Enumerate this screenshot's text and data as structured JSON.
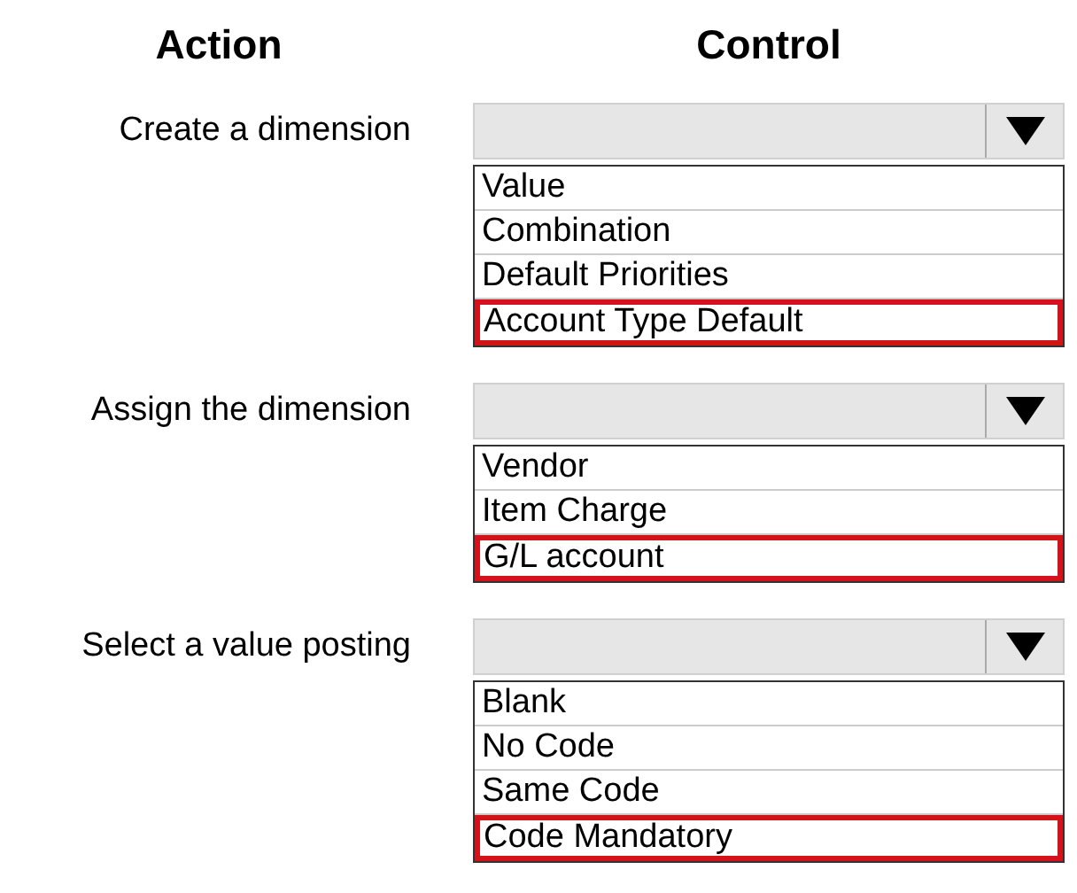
{
  "headers": [
    "Action",
    "Control"
  ],
  "rows": [
    {
      "action": "Create a dimension",
      "options": [
        {
          "label": "Value",
          "selected": false
        },
        {
          "label": "Combination",
          "selected": false
        },
        {
          "label": "Default Priorities",
          "selected": false
        },
        {
          "label": "Account Type Default",
          "selected": true
        }
      ]
    },
    {
      "action": "Assign the dimension",
      "options": [
        {
          "label": "Vendor",
          "selected": false
        },
        {
          "label": "Item Charge",
          "selected": false
        },
        {
          "label": "G/L account",
          "selected": true
        }
      ]
    },
    {
      "action": "Select a value posting",
      "options": [
        {
          "label": "Blank",
          "selected": false
        },
        {
          "label": "No Code",
          "selected": false
        },
        {
          "label": "Same Code",
          "selected": false
        },
        {
          "label": "Code Mandatory",
          "selected": true
        }
      ]
    }
  ]
}
